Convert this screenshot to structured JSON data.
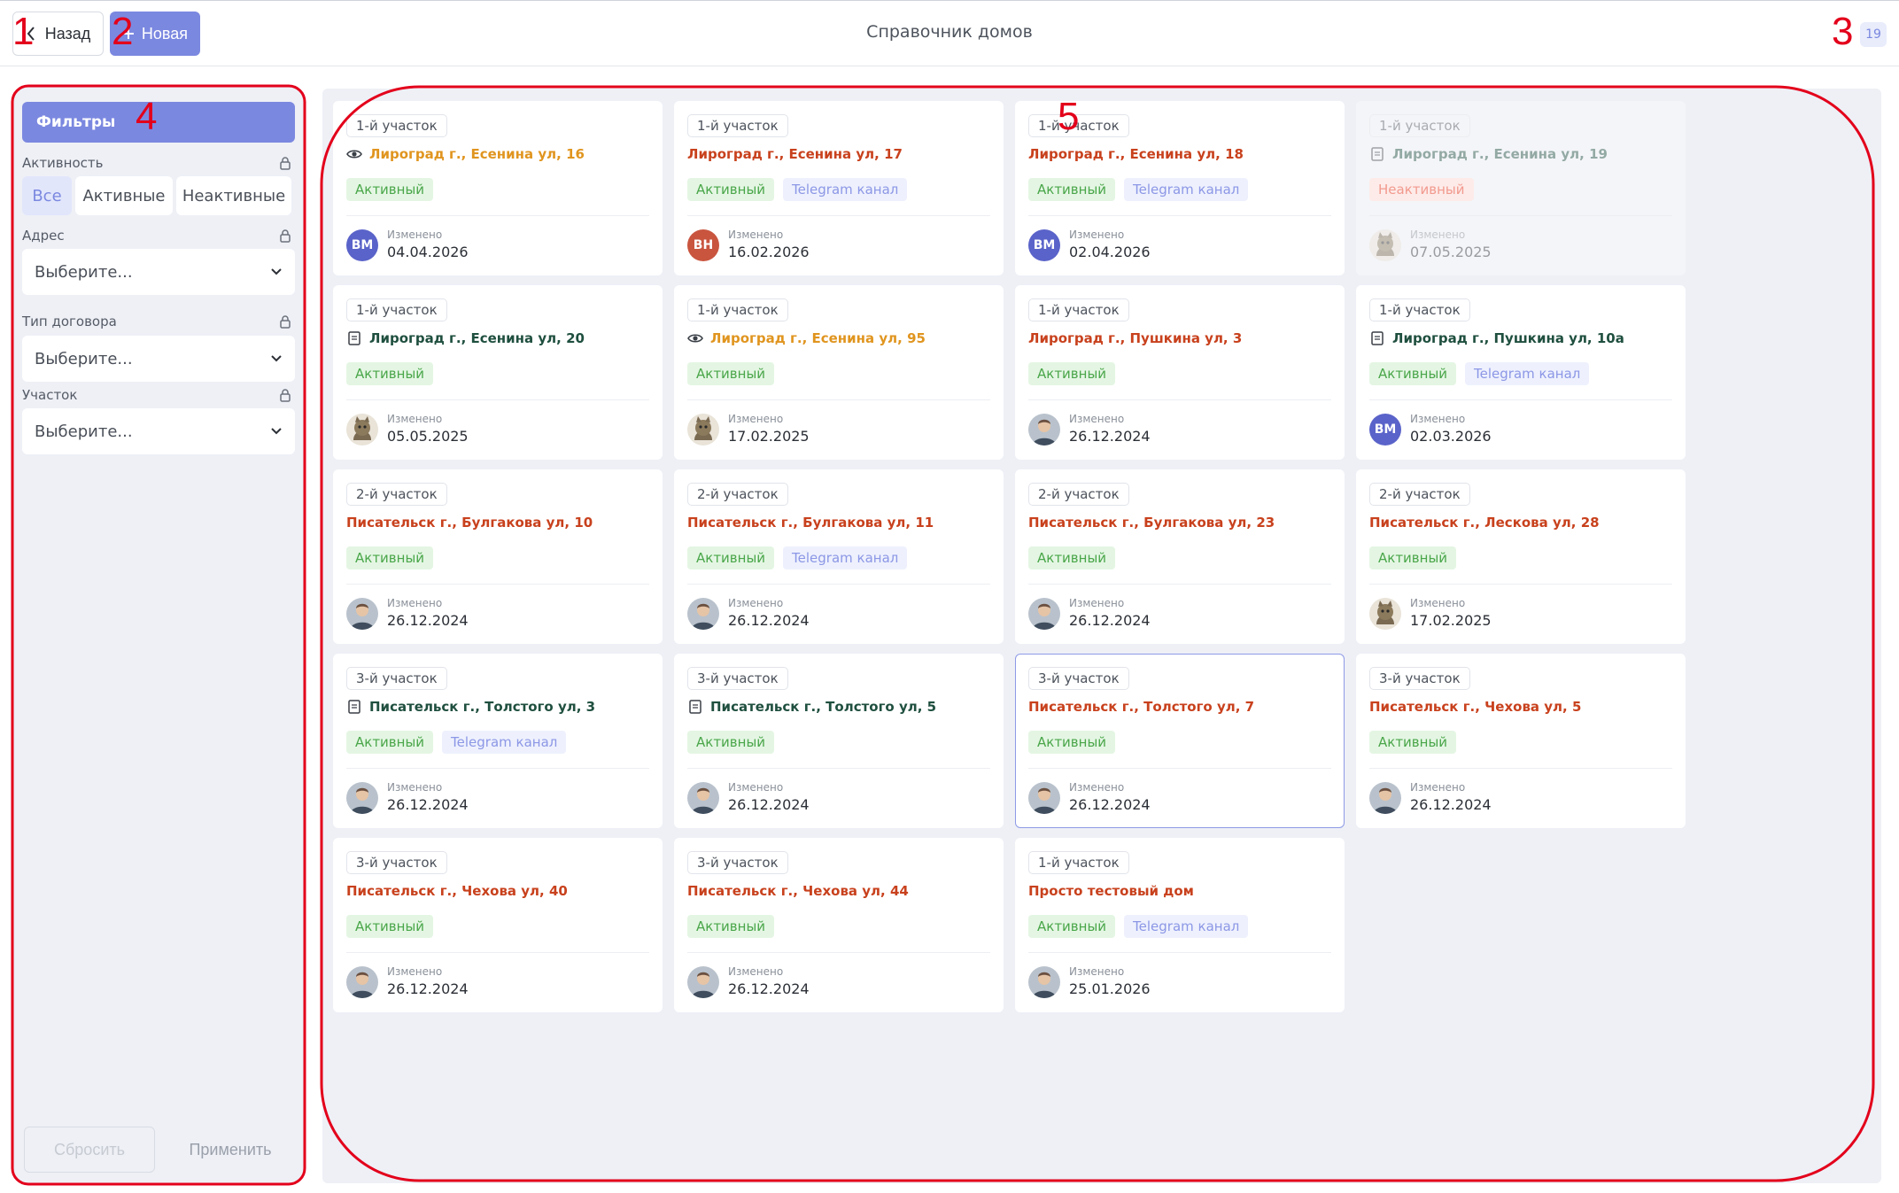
{
  "topbar": {
    "back_label": "Назад",
    "new_label": "Новая",
    "title": "Справочник домов",
    "count": "19"
  },
  "annotations": [
    "1",
    "2",
    "3",
    "4",
    "5"
  ],
  "filters": {
    "header": "Фильтры",
    "activity_label": "Активность",
    "activity_options": [
      "Все",
      "Активные",
      "Неактивные"
    ],
    "activity_selected": "Все",
    "address_label": "Адрес",
    "contract_label": "Тип договора",
    "sector_label": "Участок",
    "select_placeholder": "Выберите...",
    "reset_label": "Сбросить",
    "apply_label": "Применить"
  },
  "colors": {
    "accent": "#7b88e0",
    "address_orange": "#e0951f",
    "address_red": "#c8411d",
    "address_green": "#1f4f3f",
    "active_green": "#4aa64a",
    "annotation_red": "#e3001b"
  },
  "card_labels": {
    "changed": "Изменено"
  },
  "houses": [
    {
      "sector": "1-й участок",
      "address": "Лироград г., Есенина ул, 16",
      "addr_color": "orange",
      "addr_icon": "eye-icon",
      "status": "Активный",
      "status_type": "active",
      "telegram": "",
      "avatar_type": "initials",
      "avatar_text": "ВМ",
      "avatar_color": "#5a63c9",
      "date": "04.04.2026"
    },
    {
      "sector": "1-й участок",
      "address": "Лироград г., Есенина ул, 17",
      "addr_color": "red",
      "addr_icon": "",
      "status": "Активный",
      "status_type": "active",
      "telegram": "Telegram канал",
      "avatar_type": "initials",
      "avatar_text": "ВН",
      "avatar_color": "#c9553f",
      "date": "16.02.2026"
    },
    {
      "sector": "1-й участок",
      "address": "Лироград г., Есенина ул, 18",
      "addr_color": "red",
      "addr_icon": "",
      "status": "Активный",
      "status_type": "active",
      "telegram": "Telegram канал",
      "avatar_type": "initials",
      "avatar_text": "ВМ",
      "avatar_color": "#5a63c9",
      "date": "02.04.2026"
    },
    {
      "sector": "1-й участок",
      "address": "Лироград г., Есенина ул, 19",
      "addr_color": "green",
      "addr_icon": "document-icon",
      "status": "Неактивный",
      "status_type": "inactive",
      "telegram": "",
      "avatar_type": "cat",
      "avatar_text": "",
      "avatar_color": "",
      "date": "07.05.2025",
      "faded": true
    },
    {
      "sector": "1-й участок",
      "address": "Лироград г., Есенина ул, 20",
      "addr_color": "green",
      "addr_icon": "document-icon",
      "status": "Активный",
      "status_type": "active",
      "telegram": "",
      "avatar_type": "cat",
      "avatar_text": "",
      "avatar_color": "",
      "date": "05.05.2025"
    },
    {
      "sector": "1-й участок",
      "address": "Лироград г., Есенина ул, 95",
      "addr_color": "orange",
      "addr_icon": "eye-icon",
      "status": "Активный",
      "status_type": "active",
      "telegram": "",
      "avatar_type": "cat",
      "avatar_text": "",
      "avatar_color": "",
      "date": "17.02.2025"
    },
    {
      "sector": "1-й участок",
      "address": "Лироград г., Пушкина ул, 3",
      "addr_color": "red",
      "addr_icon": "",
      "status": "Активный",
      "status_type": "active",
      "telegram": "",
      "avatar_type": "person",
      "avatar_text": "",
      "avatar_color": "",
      "date": "26.12.2024"
    },
    {
      "sector": "1-й участок",
      "address": "Лироград г., Пушкина ул, 10а",
      "addr_color": "green",
      "addr_icon": "document-icon",
      "status": "Активный",
      "status_type": "active",
      "telegram": "Telegram канал",
      "avatar_type": "initials",
      "avatar_text": "ВМ",
      "avatar_color": "#5a63c9",
      "date": "02.03.2026"
    },
    {
      "sector": "2-й участок",
      "address": "Писательск г., Булгакова ул, 10",
      "addr_color": "red",
      "addr_icon": "",
      "status": "Активный",
      "status_type": "active",
      "telegram": "",
      "avatar_type": "person",
      "avatar_text": "",
      "avatar_color": "",
      "date": "26.12.2024"
    },
    {
      "sector": "2-й участок",
      "address": "Писательск г., Булгакова ул, 11",
      "addr_color": "red",
      "addr_icon": "",
      "status": "Активный",
      "status_type": "active",
      "telegram": "Telegram канал",
      "avatar_type": "person",
      "avatar_text": "",
      "avatar_color": "",
      "date": "26.12.2024"
    },
    {
      "sector": "2-й участок",
      "address": "Писательск г., Булгакова ул, 23",
      "addr_color": "red",
      "addr_icon": "",
      "status": "Активный",
      "status_type": "active",
      "telegram": "",
      "avatar_type": "person",
      "avatar_text": "",
      "avatar_color": "",
      "date": "26.12.2024"
    },
    {
      "sector": "2-й участок",
      "address": "Писательск г., Лескова ул, 28",
      "addr_color": "red",
      "addr_icon": "",
      "status": "Активный",
      "status_type": "active",
      "telegram": "",
      "avatar_type": "cat",
      "avatar_text": "",
      "avatar_color": "",
      "date": "17.02.2025"
    },
    {
      "sector": "3-й участок",
      "address": "Писательск г., Толстого ул, 3",
      "addr_color": "green",
      "addr_icon": "document-icon",
      "status": "Активный",
      "status_type": "active",
      "telegram": "Telegram канал",
      "avatar_type": "person",
      "avatar_text": "",
      "avatar_color": "",
      "date": "26.12.2024"
    },
    {
      "sector": "3-й участок",
      "address": "Писательск г., Толстого ул, 5",
      "addr_color": "green",
      "addr_icon": "document-icon",
      "status": "Активный",
      "status_type": "active",
      "telegram": "",
      "avatar_type": "person",
      "avatar_text": "",
      "avatar_color": "",
      "date": "26.12.2024"
    },
    {
      "sector": "3-й участок",
      "address": "Писательск г., Толстого ул, 7",
      "addr_color": "red",
      "addr_icon": "",
      "status": "Активный",
      "status_type": "active",
      "telegram": "",
      "avatar_type": "person",
      "avatar_text": "",
      "avatar_color": "",
      "date": "26.12.2024",
      "selected": true
    },
    {
      "sector": "3-й участок",
      "address": "Писательск г., Чехова ул, 5",
      "addr_color": "red",
      "addr_icon": "",
      "status": "Активный",
      "status_type": "active",
      "telegram": "",
      "avatar_type": "person",
      "avatar_text": "",
      "avatar_color": "",
      "date": "26.12.2024"
    },
    {
      "sector": "3-й участок",
      "address": "Писательск г., Чехова ул, 40",
      "addr_color": "red",
      "addr_icon": "",
      "status": "Активный",
      "status_type": "active",
      "telegram": "",
      "avatar_type": "person",
      "avatar_text": "",
      "avatar_color": "",
      "date": "26.12.2024"
    },
    {
      "sector": "3-й участок",
      "address": "Писательск г., Чехова ул, 44",
      "addr_color": "red",
      "addr_icon": "",
      "status": "Активный",
      "status_type": "active",
      "telegram": "",
      "avatar_type": "person",
      "avatar_text": "",
      "avatar_color": "",
      "date": "26.12.2024"
    },
    {
      "sector": "1-й участок",
      "address": "Просто тестовый дом",
      "addr_color": "red",
      "addr_icon": "",
      "status": "Активный",
      "status_type": "active",
      "telegram": "Telegram канал",
      "avatar_type": "person",
      "avatar_text": "",
      "avatar_color": "",
      "date": "25.01.2026"
    }
  ]
}
